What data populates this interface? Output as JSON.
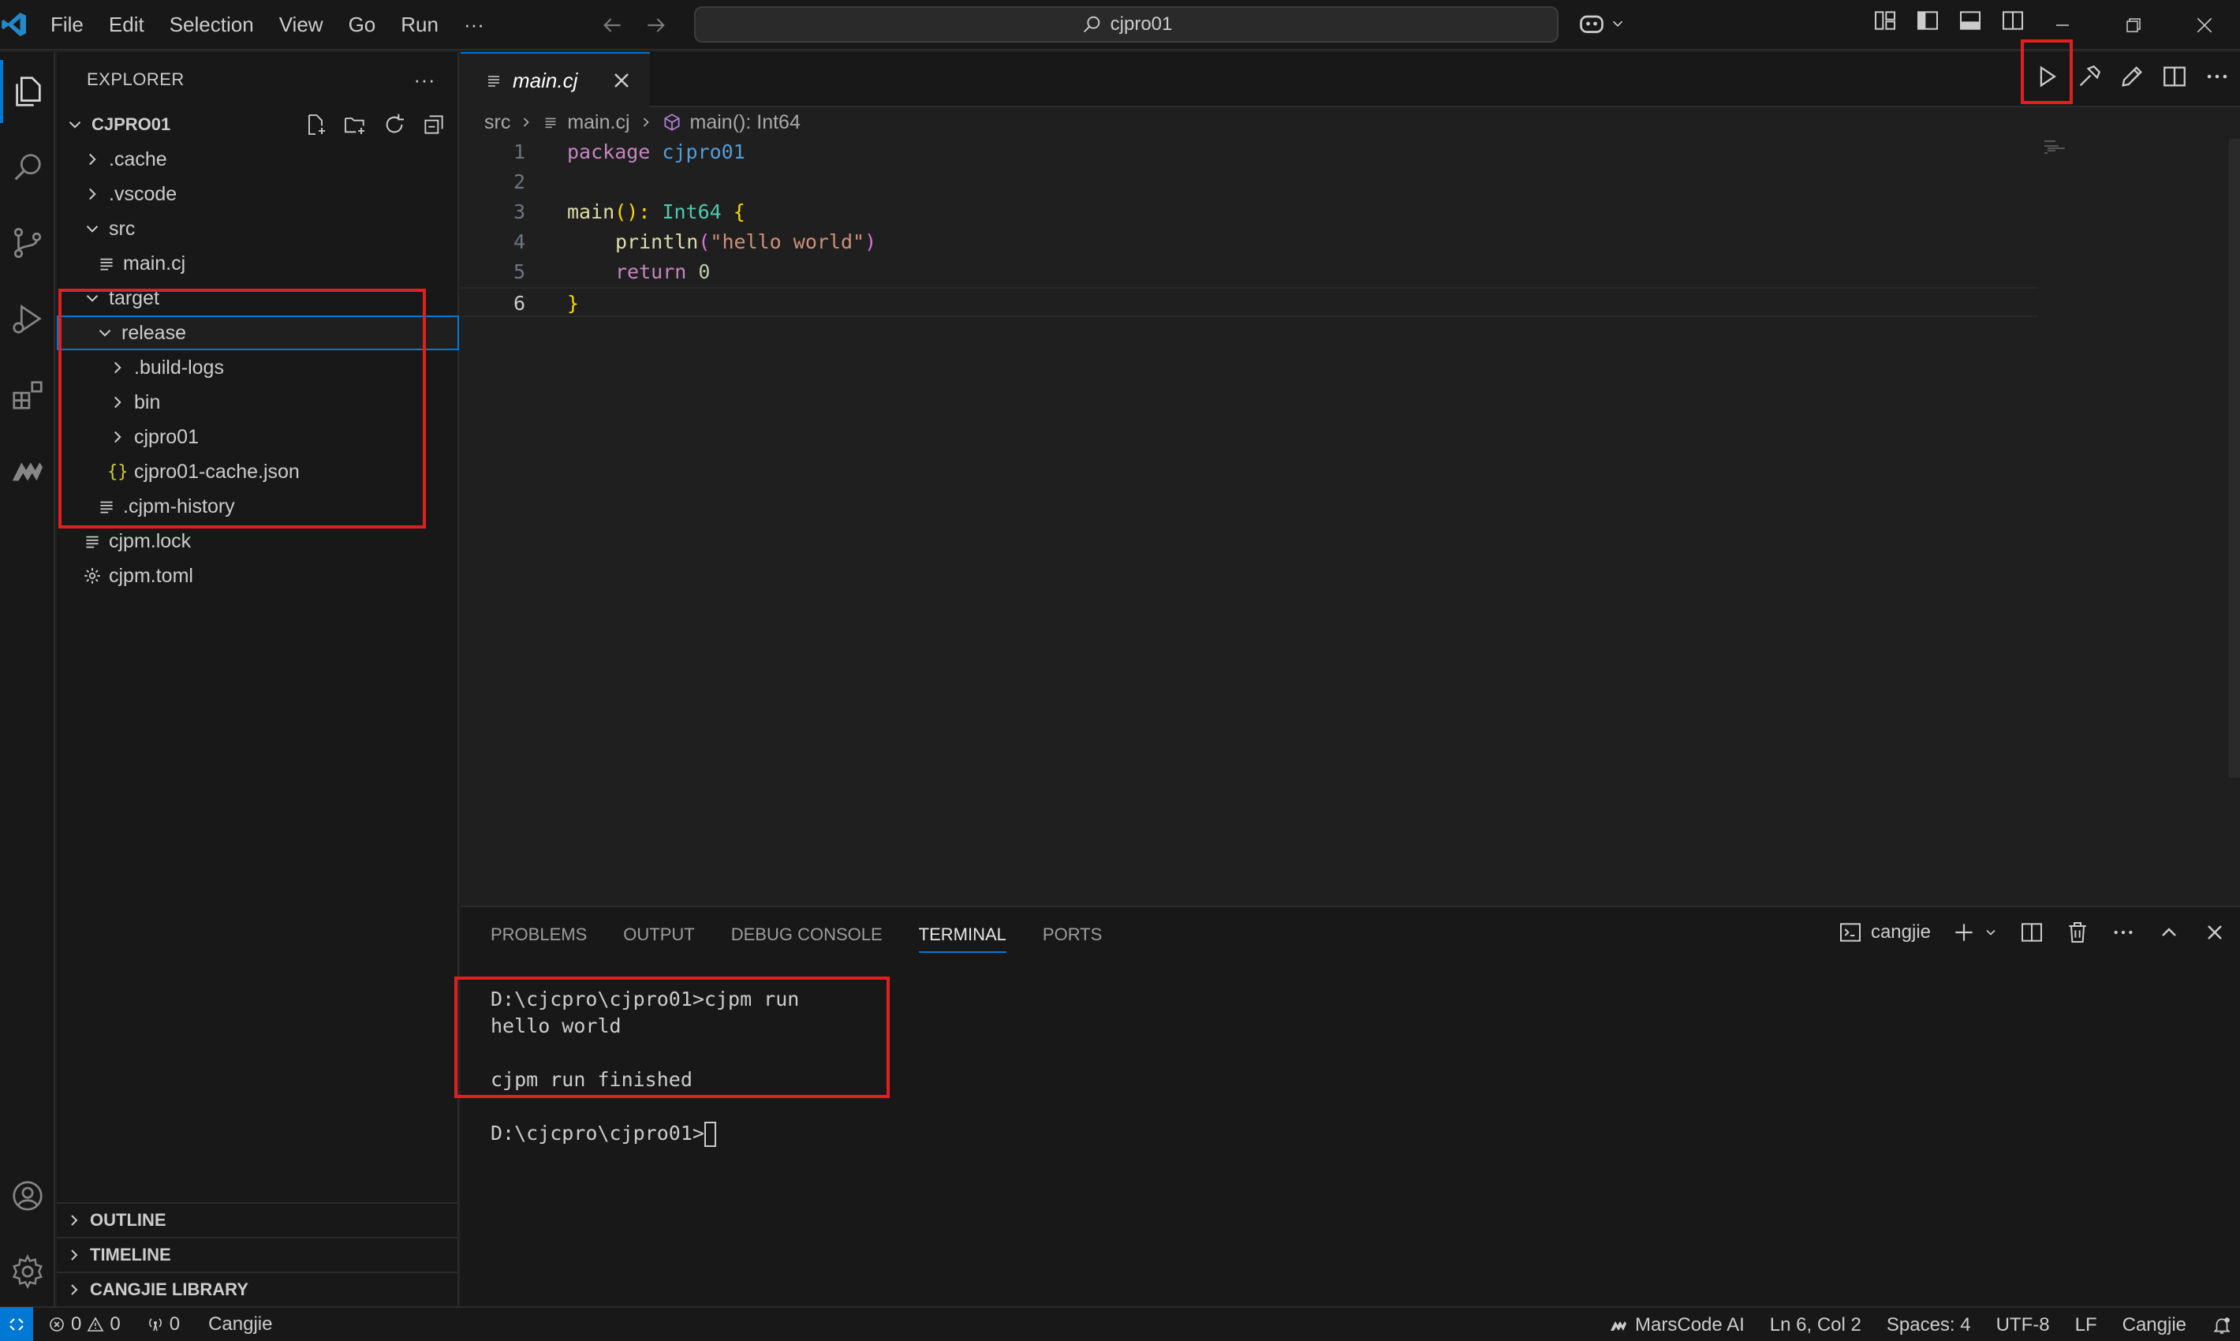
{
  "menu": [
    "File",
    "Edit",
    "Selection",
    "View",
    "Go",
    "Run",
    "···"
  ],
  "search": {
    "text": "cjpro01"
  },
  "sidebar": {
    "title": "EXPLORER",
    "more": "···",
    "project": "CJPRO01",
    "tree": [
      {
        "label": ".cache",
        "icon": "chevron-right-icon"
      },
      {
        "label": ".vscode",
        "icon": "chevron-right-icon"
      },
      {
        "label": "src",
        "icon": "chevron-down-icon"
      },
      {
        "label": "main.cj",
        "icon": "file-lines-icon"
      },
      {
        "label": "target",
        "icon": "chevron-down-icon"
      },
      {
        "label": "release",
        "icon": "chevron-down-icon"
      },
      {
        "label": ".build-logs",
        "icon": "chevron-right-icon"
      },
      {
        "label": "bin",
        "icon": "chevron-right-icon"
      },
      {
        "label": "cjpro01",
        "icon": "chevron-right-icon"
      },
      {
        "label": "cjpro01-cache.json",
        "icon": "json-icon"
      },
      {
        "label": ".cjpm-history",
        "icon": "file-lines-icon"
      },
      {
        "label": "cjpm.lock",
        "icon": "file-lines-icon"
      },
      {
        "label": "cjpm.toml",
        "icon": "gear-icon"
      }
    ],
    "sections": [
      "OUTLINE",
      "TIMELINE",
      "CANGJIE LIBRARY"
    ]
  },
  "editor": {
    "tab": "main.cj",
    "breadcrumb": {
      "folder": "src",
      "file": "main.cj",
      "symbol": "main(): Int64"
    },
    "lines": [
      "1",
      "2",
      "3",
      "4",
      "5",
      "6"
    ],
    "code": {
      "l1_kw": "package",
      "l1_pkg": "cjpro01",
      "l3_fn": "main",
      "l3_paren": "():",
      "l3_ty": "Int64",
      "l3_brace": "{",
      "l4_fn": "println",
      "l4_open": "(",
      "l4_str": "\"hello world\"",
      "l4_close": ")",
      "l5_kw": "return",
      "l5_num": "0",
      "l6_brace": "}"
    }
  },
  "panel": {
    "tabs": [
      "PROBLEMS",
      "OUTPUT",
      "DEBUG CONSOLE",
      "TERMINAL",
      "PORTS"
    ],
    "terminal_name": "cangjie",
    "terminal_lines": [
      "D:\\cjcpro\\cjpro01>cjpm run",
      "hello world",
      "",
      "cjpm run finished",
      "",
      "D:\\cjcpro\\cjpro01>"
    ]
  },
  "status": {
    "errors": "0",
    "warnings": "0",
    "ports": "0",
    "lang_left": "Cangjie",
    "marscode": "MarsCode AI",
    "position": "Ln 6, Col 2",
    "spaces": "Spaces: 4",
    "encoding": "UTF-8",
    "eol": "LF",
    "lang": "Cangjie"
  },
  "colors": {
    "accent": "#0078d4",
    "highlight": "#e02020",
    "background": "#1f1f1f"
  }
}
